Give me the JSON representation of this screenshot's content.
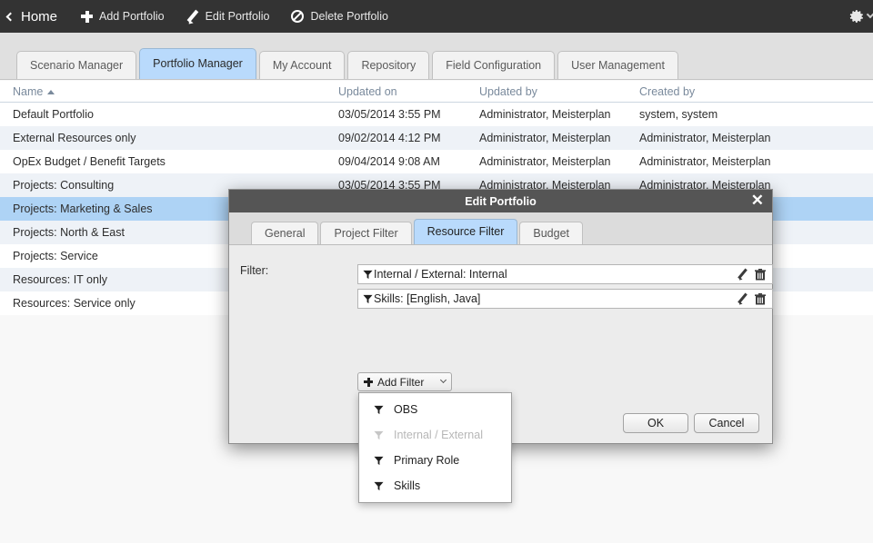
{
  "topbar": {
    "home_label": "Home",
    "back_icon": "chevron-left-icon",
    "actions": [
      {
        "label": "Add Portfolio",
        "icon": "plus-icon"
      },
      {
        "label": "Edit Portfolio",
        "icon": "pencil-icon"
      },
      {
        "label": "Delete Portfolio",
        "icon": "ban-icon"
      }
    ],
    "settings_icon": "gear-icon",
    "settings_caret_icon": "chevron-down-icon"
  },
  "tabs": [
    {
      "label": "Scenario Manager",
      "active": false
    },
    {
      "label": "Portfolio Manager",
      "active": true
    },
    {
      "label": "My Account",
      "active": false
    },
    {
      "label": "Repository",
      "active": false
    },
    {
      "label": "Field Configuration",
      "active": false
    },
    {
      "label": "User Management",
      "active": false
    }
  ],
  "table": {
    "columns": [
      "Name",
      "Updated on",
      "Updated by",
      "Created by"
    ],
    "sort_column": "Name",
    "sort_direction_icon": "sort-ascending-caret-icon",
    "rows": [
      {
        "name": "Default Portfolio",
        "updated_on": "03/05/2014 3:55 PM",
        "updated_by": "Administrator, Meisterplan",
        "created_by": "system, system"
      },
      {
        "name": "External Resources only",
        "updated_on": "09/02/2014 4:12 PM",
        "updated_by": "Administrator, Meisterplan",
        "created_by": "Administrator, Meisterplan"
      },
      {
        "name": "OpEx Budget / Benefit Targets",
        "updated_on": "09/04/2014 9:08 AM",
        "updated_by": "Administrator, Meisterplan",
        "created_by": "Administrator, Meisterplan"
      },
      {
        "name": "Projects: Consulting",
        "updated_on": "03/05/2014 3:55 PM",
        "updated_by": "Administrator, Meisterplan",
        "created_by": "Administrator, Meisterplan"
      },
      {
        "name": "Projects: Marketing & Sales",
        "updated_on": "",
        "updated_by": "",
        "created_by": ""
      },
      {
        "name": "Projects: North & East",
        "updated_on": "",
        "updated_by": "",
        "created_by": ""
      },
      {
        "name": "Projects: Service",
        "updated_on": "",
        "updated_by": "",
        "created_by": ""
      },
      {
        "name": "Resources: IT only",
        "updated_on": "",
        "updated_by": "",
        "created_by": ""
      },
      {
        "name": "Resources: Service only",
        "updated_on": "",
        "updated_by": "",
        "created_by": ""
      }
    ]
  },
  "dialog": {
    "title": "Edit Portfolio",
    "close_icon": "close-icon",
    "tabs": [
      {
        "label": "General",
        "active": false
      },
      {
        "label": "Project Filter",
        "active": false
      },
      {
        "label": "Resource Filter",
        "active": true
      },
      {
        "label": "Budget",
        "active": false
      }
    ],
    "filter_label": "Filter:",
    "filters": [
      {
        "text": "Internal / External: Internal",
        "icon": "funnel-icon",
        "edit_icon": "pencil-icon",
        "delete_icon": "trash-icon"
      },
      {
        "text": "Skills: [English, Java]",
        "icon": "funnel-icon",
        "edit_icon": "pencil-icon",
        "delete_icon": "trash-icon"
      }
    ],
    "add_filter": {
      "label": "Add Filter",
      "plus_icon": "plus-icon",
      "caret_icon": "chevron-down-icon"
    },
    "dropdown_options": [
      {
        "label": "OBS",
        "icon": "funnel-icon",
        "disabled": false
      },
      {
        "label": "Internal / External",
        "icon": "funnel-icon",
        "disabled": true
      },
      {
        "label": "Primary Role",
        "icon": "funnel-icon",
        "disabled": false
      },
      {
        "label": "Skills",
        "icon": "funnel-icon",
        "disabled": false
      }
    ],
    "ok_label": "OK",
    "cancel_label": "Cancel"
  },
  "colors": {
    "topbar_bg": "#333333",
    "tab_active_bg": "#b9dafc",
    "row_selected_bg": "#aed3f5",
    "row_alt_bg": "#eef2f7",
    "dialog_title_bg": "#555555",
    "page_bg": "#f8f8f8"
  }
}
